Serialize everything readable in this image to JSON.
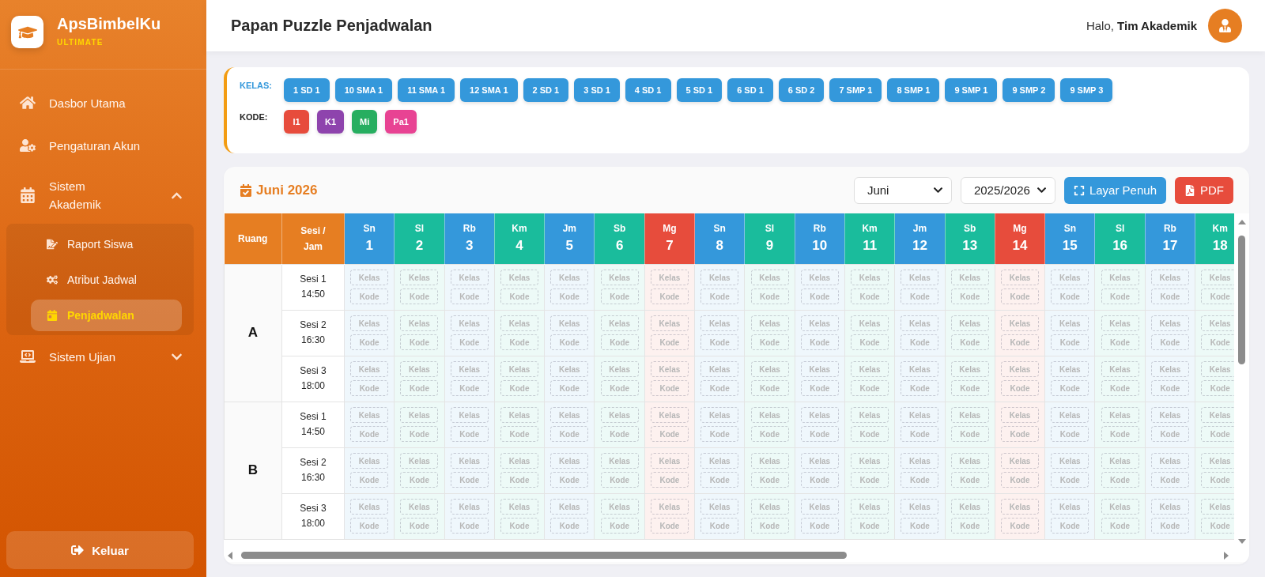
{
  "sidebar": {
    "brand": {
      "name": "ApsBimbelKu",
      "edition": "ULTIMATE"
    },
    "menu": [
      {
        "kind": "link",
        "label": "Dasbor Utama",
        "selected": false
      },
      {
        "kind": "link",
        "label": "Pengaturan Akun",
        "selected": false
      },
      {
        "kind": "group",
        "label": "Sistem Akademik",
        "selected": false,
        "expanded": true,
        "children": [
          {
            "label": "Raport Siswa",
            "selected": false
          },
          {
            "label": "Atribut Jadwal",
            "selected": false
          },
          {
            "label": "Penjadwalan",
            "selected": true
          }
        ]
      },
      {
        "kind": "group",
        "label": "Sistem Ujian",
        "selected": false,
        "expanded": false
      }
    ],
    "logout_button": "Keluar"
  },
  "header": {
    "title": "Papan Puzzle Penjadwalan",
    "greeting": "Halo, **Tim Akademik**"
  },
  "legend": {
    "kelas": {
      "label": "KELAS:",
      "items": [
        "1 SD 1",
        "10 SMA 1",
        "11 SMA 1",
        "12 SMA 1",
        "2 SD 1",
        "3 SD 1",
        "4 SD 1",
        "5 SD 1",
        "6 SD 1",
        "6 SD 2",
        "7 SMP 1",
        "8 SMP 1",
        "9 SMP 1",
        "9 SMP 2",
        "9 SMP 3"
      ]
    },
    "kode": {
      "label": "KODE:",
      "items": [
        {
          "label": "I1",
          "color": "#e74c3c"
        },
        {
          "label": "K1",
          "color": "#8e44ad"
        },
        {
          "label": "Mi",
          "color": "#27ae60"
        },
        {
          "label": "Pa1",
          "color": "#e84393"
        }
      ]
    }
  },
  "calendar": {
    "title": "Juni 2026",
    "month_select": {
      "value": "Juni"
    },
    "year_select": {
      "value": "2025/2026"
    },
    "buttons": [
      {
        "kind": "fullscreen",
        "label": "Layar Penuh"
      },
      {
        "kind": "pdf",
        "label": "PDF"
      }
    ]
  },
  "schedule": {
    "columns": {
      "room": "Ruang",
      "session": "Sesi / Jam"
    },
    "days": [
      {
        "abbr": "Sn",
        "date": "1",
        "color": "#3498db"
      },
      {
        "abbr": "Sl",
        "date": "2",
        "color": "#1abc9c"
      },
      {
        "abbr": "Rb",
        "date": "3",
        "color": "#3498db"
      },
      {
        "abbr": "Km",
        "date": "4",
        "color": "#1abc9c"
      },
      {
        "abbr": "Jm",
        "date": "5",
        "color": "#3498db"
      },
      {
        "abbr": "Sb",
        "date": "6",
        "color": "#1abc9c"
      },
      {
        "abbr": "Mg",
        "date": "7",
        "color": "#e74c3c"
      },
      {
        "abbr": "Sn",
        "date": "8",
        "color": "#3498db"
      },
      {
        "abbr": "Sl",
        "date": "9",
        "color": "#1abc9c"
      },
      {
        "abbr": "Rb",
        "date": "10",
        "color": "#3498db"
      },
      {
        "abbr": "Km",
        "date": "11",
        "color": "#1abc9c"
      },
      {
        "abbr": "Jm",
        "date": "12",
        "color": "#3498db"
      },
      {
        "abbr": "Sb",
        "date": "13",
        "color": "#1abc9c"
      },
      {
        "abbr": "Mg",
        "date": "14",
        "color": "#e74c3c"
      },
      {
        "abbr": "Sn",
        "date": "15",
        "color": "#3498db"
      },
      {
        "abbr": "Sl",
        "date": "16",
        "color": "#1abc9c"
      },
      {
        "abbr": "Rb",
        "date": "17",
        "color": "#3498db"
      },
      {
        "abbr": "Km",
        "date": "18",
        "color": "#1abc9c"
      }
    ],
    "rooms": [
      {
        "name": "A",
        "sessions": [
          {
            "label": "Sesi 1",
            "time": "14:50",
            "slots": [
              {
                "class_slot": "Kelas",
                "code_slot": "Kode"
              },
              {
                "class_slot": "Kelas",
                "code_slot": "Kode"
              },
              {
                "class_slot": "Kelas",
                "code_slot": "Kode"
              },
              {
                "class_slot": "Kelas",
                "code_slot": "Kode"
              },
              {
                "class_slot": "Kelas",
                "code_slot": "Kode"
              },
              {
                "class_slot": "Kelas",
                "code_slot": "Kode"
              },
              {
                "class_slot": "Kelas",
                "code_slot": "Kode"
              },
              {
                "class_slot": "Kelas",
                "code_slot": "Kode"
              },
              {
                "class_slot": "Kelas",
                "code_slot": "Kode"
              },
              {
                "class_slot": "Kelas",
                "code_slot": "Kode"
              },
              {
                "class_slot": "Kelas",
                "code_slot": "Kode"
              },
              {
                "class_slot": "Kelas",
                "code_slot": "Kode"
              },
              {
                "class_slot": "Kelas",
                "code_slot": "Kode"
              },
              {
                "class_slot": "Kelas",
                "code_slot": "Kode"
              },
              {
                "class_slot": "Kelas",
                "code_slot": "Kode"
              },
              {
                "class_slot": "Kelas",
                "code_slot": "Kode"
              },
              {
                "class_slot": "Kelas",
                "code_slot": "Kode"
              },
              {
                "class_slot": "Kelas",
                "code_slot": "Kode"
              }
            ]
          },
          {
            "label": "Sesi 2",
            "time": "16:30",
            "slots": [
              {
                "class_slot": "Kelas",
                "code_slot": "Kode"
              },
              {
                "class_slot": "Kelas",
                "code_slot": "Kode"
              },
              {
                "class_slot": "Kelas",
                "code_slot": "Kode"
              },
              {
                "class_slot": "Kelas",
                "code_slot": "Kode"
              },
              {
                "class_slot": "Kelas",
                "code_slot": "Kode"
              },
              {
                "class_slot": "Kelas",
                "code_slot": "Kode"
              },
              {
                "class_slot": "Kelas",
                "code_slot": "Kode"
              },
              {
                "class_slot": "Kelas",
                "code_slot": "Kode"
              },
              {
                "class_slot": "Kelas",
                "code_slot": "Kode"
              },
              {
                "class_slot": "Kelas",
                "code_slot": "Kode"
              },
              {
                "class_slot": "Kelas",
                "code_slot": "Kode"
              },
              {
                "class_slot": "Kelas",
                "code_slot": "Kode"
              },
              {
                "class_slot": "Kelas",
                "code_slot": "Kode"
              },
              {
                "class_slot": "Kelas",
                "code_slot": "Kode"
              },
              {
                "class_slot": "Kelas",
                "code_slot": "Kode"
              },
              {
                "class_slot": "Kelas",
                "code_slot": "Kode"
              },
              {
                "class_slot": "Kelas",
                "code_slot": "Kode"
              },
              {
                "class_slot": "Kelas",
                "code_slot": "Kode"
              }
            ]
          },
          {
            "label": "Sesi 3",
            "time": "18:00",
            "slots": [
              {
                "class_slot": "Kelas",
                "code_slot": "Kode"
              },
              {
                "class_slot": "Kelas",
                "code_slot": "Kode"
              },
              {
                "class_slot": "Kelas",
                "code_slot": "Kode"
              },
              {
                "class_slot": "Kelas",
                "code_slot": "Kode"
              },
              {
                "class_slot": "Kelas",
                "code_slot": "Kode"
              },
              {
                "class_slot": "Kelas",
                "code_slot": "Kode"
              },
              {
                "class_slot": "Kelas",
                "code_slot": "Kode"
              },
              {
                "class_slot": "Kelas",
                "code_slot": "Kode"
              },
              {
                "class_slot": "Kelas",
                "code_slot": "Kode"
              },
              {
                "class_slot": "Kelas",
                "code_slot": "Kode"
              },
              {
                "class_slot": "Kelas",
                "code_slot": "Kode"
              },
              {
                "class_slot": "Kelas",
                "code_slot": "Kode"
              },
              {
                "class_slot": "Kelas",
                "code_slot": "Kode"
              },
              {
                "class_slot": "Kelas",
                "code_slot": "Kode"
              },
              {
                "class_slot": "Kelas",
                "code_slot": "Kode"
              },
              {
                "class_slot": "Kelas",
                "code_slot": "Kode"
              },
              {
                "class_slot": "Kelas",
                "code_slot": "Kode"
              },
              {
                "class_slot": "Kelas",
                "code_slot": "Kode"
              }
            ]
          }
        ]
      },
      {
        "name": "B",
        "sessions": [
          {
            "label": "Sesi 1",
            "time": "14:50",
            "slots": [
              {
                "class_slot": "Kelas",
                "code_slot": "Kode"
              },
              {
                "class_slot": "Kelas",
                "code_slot": "Kode"
              },
              {
                "class_slot": "Kelas",
                "code_slot": "Kode"
              },
              {
                "class_slot": "Kelas",
                "code_slot": "Kode"
              },
              {
                "class_slot": "Kelas",
                "code_slot": "Kode"
              },
              {
                "class_slot": "Kelas",
                "code_slot": "Kode"
              },
              {
                "class_slot": "Kelas",
                "code_slot": "Kode"
              },
              {
                "class_slot": "Kelas",
                "code_slot": "Kode"
              },
              {
                "class_slot": "Kelas",
                "code_slot": "Kode"
              },
              {
                "class_slot": "Kelas",
                "code_slot": "Kode"
              },
              {
                "class_slot": "Kelas",
                "code_slot": "Kode"
              },
              {
                "class_slot": "Kelas",
                "code_slot": "Kode"
              },
              {
                "class_slot": "Kelas",
                "code_slot": "Kode"
              },
              {
                "class_slot": "Kelas",
                "code_slot": "Kode"
              },
              {
                "class_slot": "Kelas",
                "code_slot": "Kode"
              },
              {
                "class_slot": "Kelas",
                "code_slot": "Kode"
              },
              {
                "class_slot": "Kelas",
                "code_slot": "Kode"
              },
              {
                "class_slot": "Kelas",
                "code_slot": "Kode"
              }
            ]
          },
          {
            "label": "Sesi 2",
            "time": "16:30",
            "slots": [
              {
                "class_slot": "Kelas",
                "code_slot": "Kode"
              },
              {
                "class_slot": "Kelas",
                "code_slot": "Kode"
              },
              {
                "class_slot": "Kelas",
                "code_slot": "Kode"
              },
              {
                "class_slot": "Kelas",
                "code_slot": "Kode"
              },
              {
                "class_slot": "Kelas",
                "code_slot": "Kode"
              },
              {
                "class_slot": "Kelas",
                "code_slot": "Kode"
              },
              {
                "class_slot": "Kelas",
                "code_slot": "Kode"
              },
              {
                "class_slot": "Kelas",
                "code_slot": "Kode"
              },
              {
                "class_slot": "Kelas",
                "code_slot": "Kode"
              },
              {
                "class_slot": "Kelas",
                "code_slot": "Kode"
              },
              {
                "class_slot": "Kelas",
                "code_slot": "Kode"
              },
              {
                "class_slot": "Kelas",
                "code_slot": "Kode"
              },
              {
                "class_slot": "Kelas",
                "code_slot": "Kode"
              },
              {
                "class_slot": "Kelas",
                "code_slot": "Kode"
              },
              {
                "class_slot": "Kelas",
                "code_slot": "Kode"
              },
              {
                "class_slot": "Kelas",
                "code_slot": "Kode"
              },
              {
                "class_slot": "Kelas",
                "code_slot": "Kode"
              },
              {
                "class_slot": "Kelas",
                "code_slot": "Kode"
              }
            ]
          },
          {
            "label": "Sesi 3",
            "time": "18:00",
            "slots": [
              {
                "class_slot": "Kelas",
                "code_slot": "Kode"
              },
              {
                "class_slot": "Kelas",
                "code_slot": "Kode"
              },
              {
                "class_slot": "Kelas",
                "code_slot": "Kode"
              },
              {
                "class_slot": "Kelas",
                "code_slot": "Kode"
              },
              {
                "class_slot": "Kelas",
                "code_slot": "Kode"
              },
              {
                "class_slot": "Kelas",
                "code_slot": "Kode"
              },
              {
                "class_slot": "Kelas",
                "code_slot": "Kode"
              },
              {
                "class_slot": "Kelas",
                "code_slot": "Kode"
              },
              {
                "class_slot": "Kelas",
                "code_slot": "Kode"
              },
              {
                "class_slot": "Kelas",
                "code_slot": "Kode"
              },
              {
                "class_slot": "Kelas",
                "code_slot": "Kode"
              },
              {
                "class_slot": "Kelas",
                "code_slot": "Kode"
              },
              {
                "class_slot": "Kelas",
                "code_slot": "Kode"
              },
              {
                "class_slot": "Kelas",
                "code_slot": "Kode"
              },
              {
                "class_slot": "Kelas",
                "code_slot": "Kode"
              },
              {
                "class_slot": "Kelas",
                "code_slot": "Kode"
              },
              {
                "class_slot": "Kelas",
                "code_slot": "Kode"
              },
              {
                "class_slot": "Kelas",
                "code_slot": "Kode"
              }
            ]
          }
        ]
      }
    ]
  }
}
